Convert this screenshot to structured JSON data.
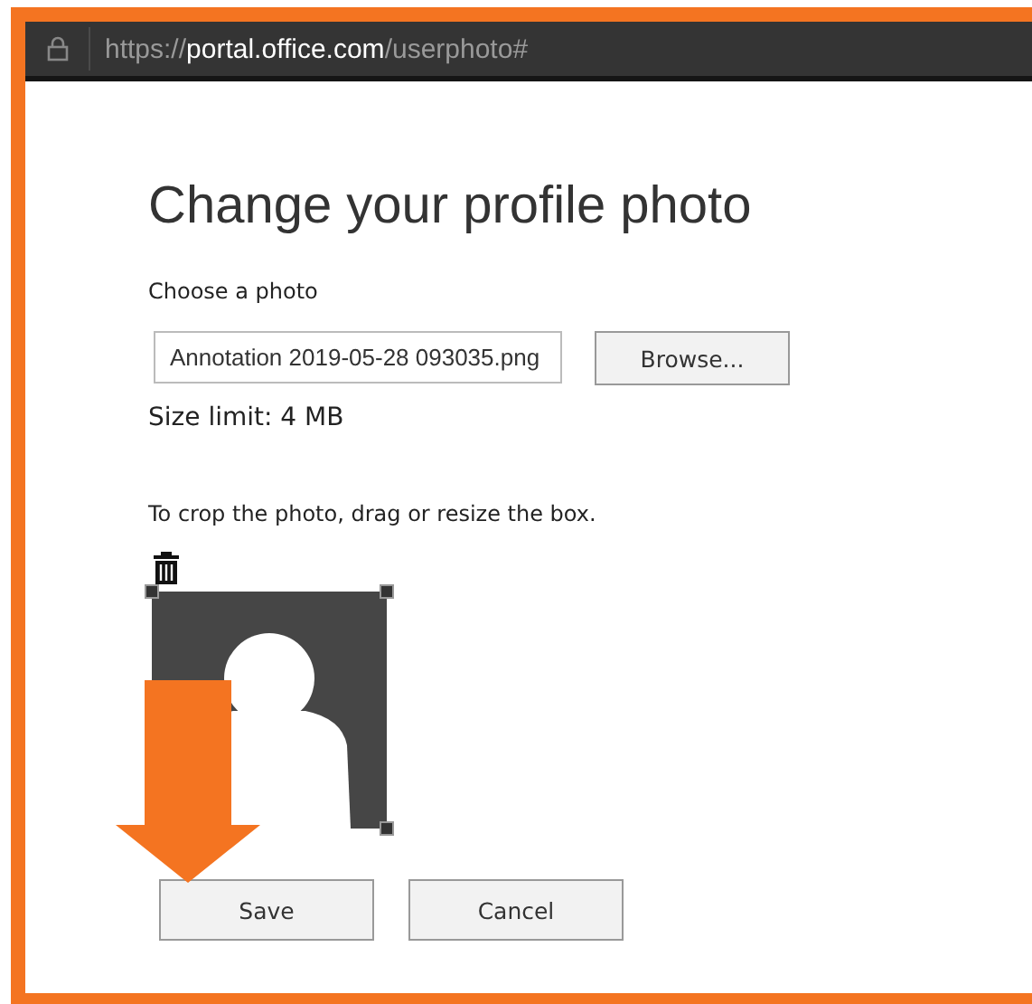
{
  "address_bar": {
    "url_parts": [
      {
        "text": "https://",
        "kind": "dim"
      },
      {
        "text": "portal.office.com",
        "kind": "host"
      },
      {
        "text": "/userphoto#",
        "kind": "dim"
      }
    ]
  },
  "title": "Change your profile photo",
  "choose_label": "Choose a photo",
  "file_field": {
    "value": "Annotation 2019-05-28 093035.png"
  },
  "browse_button": "Browse...",
  "size_limit": "Size limit: 4 MB",
  "crop_hint": "To crop the photo, drag or resize the box.",
  "buttons": [
    "Save",
    "Cancel"
  ]
}
